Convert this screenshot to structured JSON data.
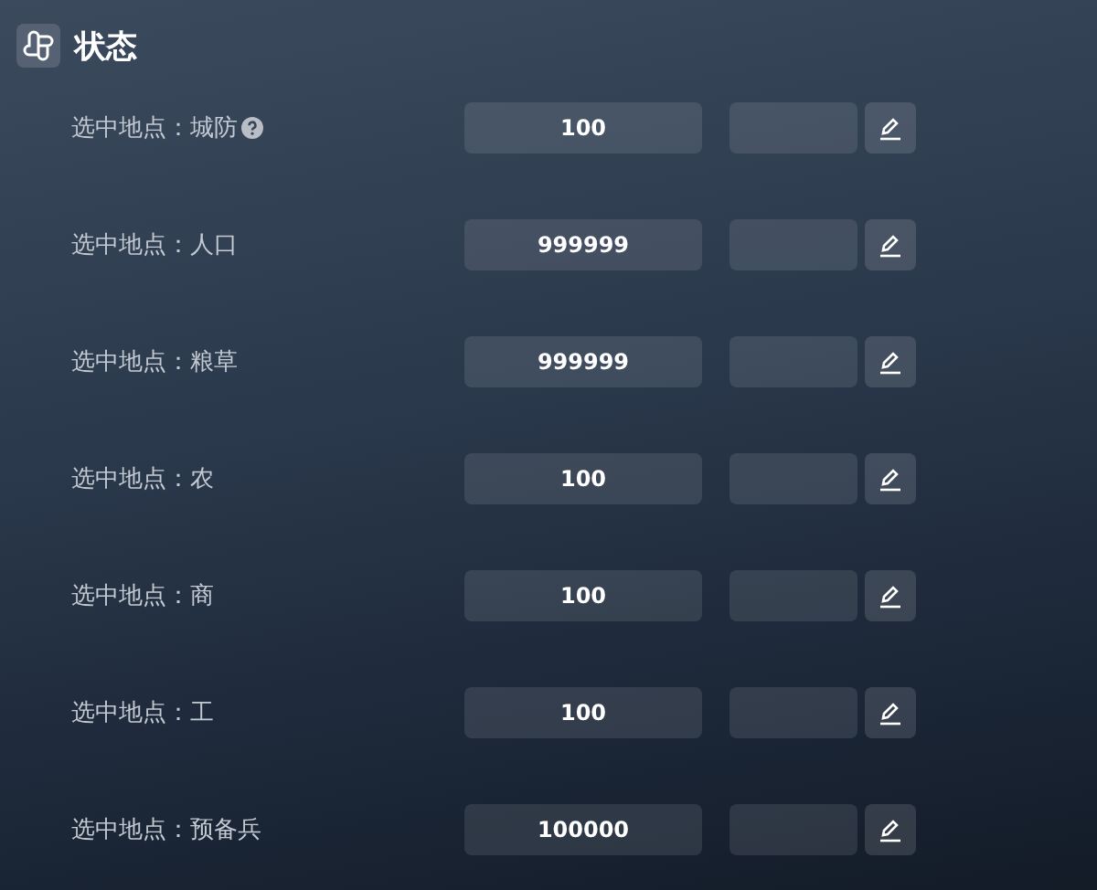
{
  "section": {
    "title": "状态"
  },
  "rows": [
    {
      "label": "选中地点：城防",
      "help": true,
      "value": "100"
    },
    {
      "label": "选中地点：人口",
      "help": false,
      "value": "999999"
    },
    {
      "label": "选中地点：粮草",
      "help": false,
      "value": "999999"
    },
    {
      "label": "选中地点：农",
      "help": false,
      "value": "100"
    },
    {
      "label": "选中地点：商",
      "help": false,
      "value": "100"
    },
    {
      "label": "选中地点：工",
      "help": false,
      "value": "100"
    },
    {
      "label": "选中地点：预备兵",
      "help": false,
      "value": "100000"
    }
  ]
}
